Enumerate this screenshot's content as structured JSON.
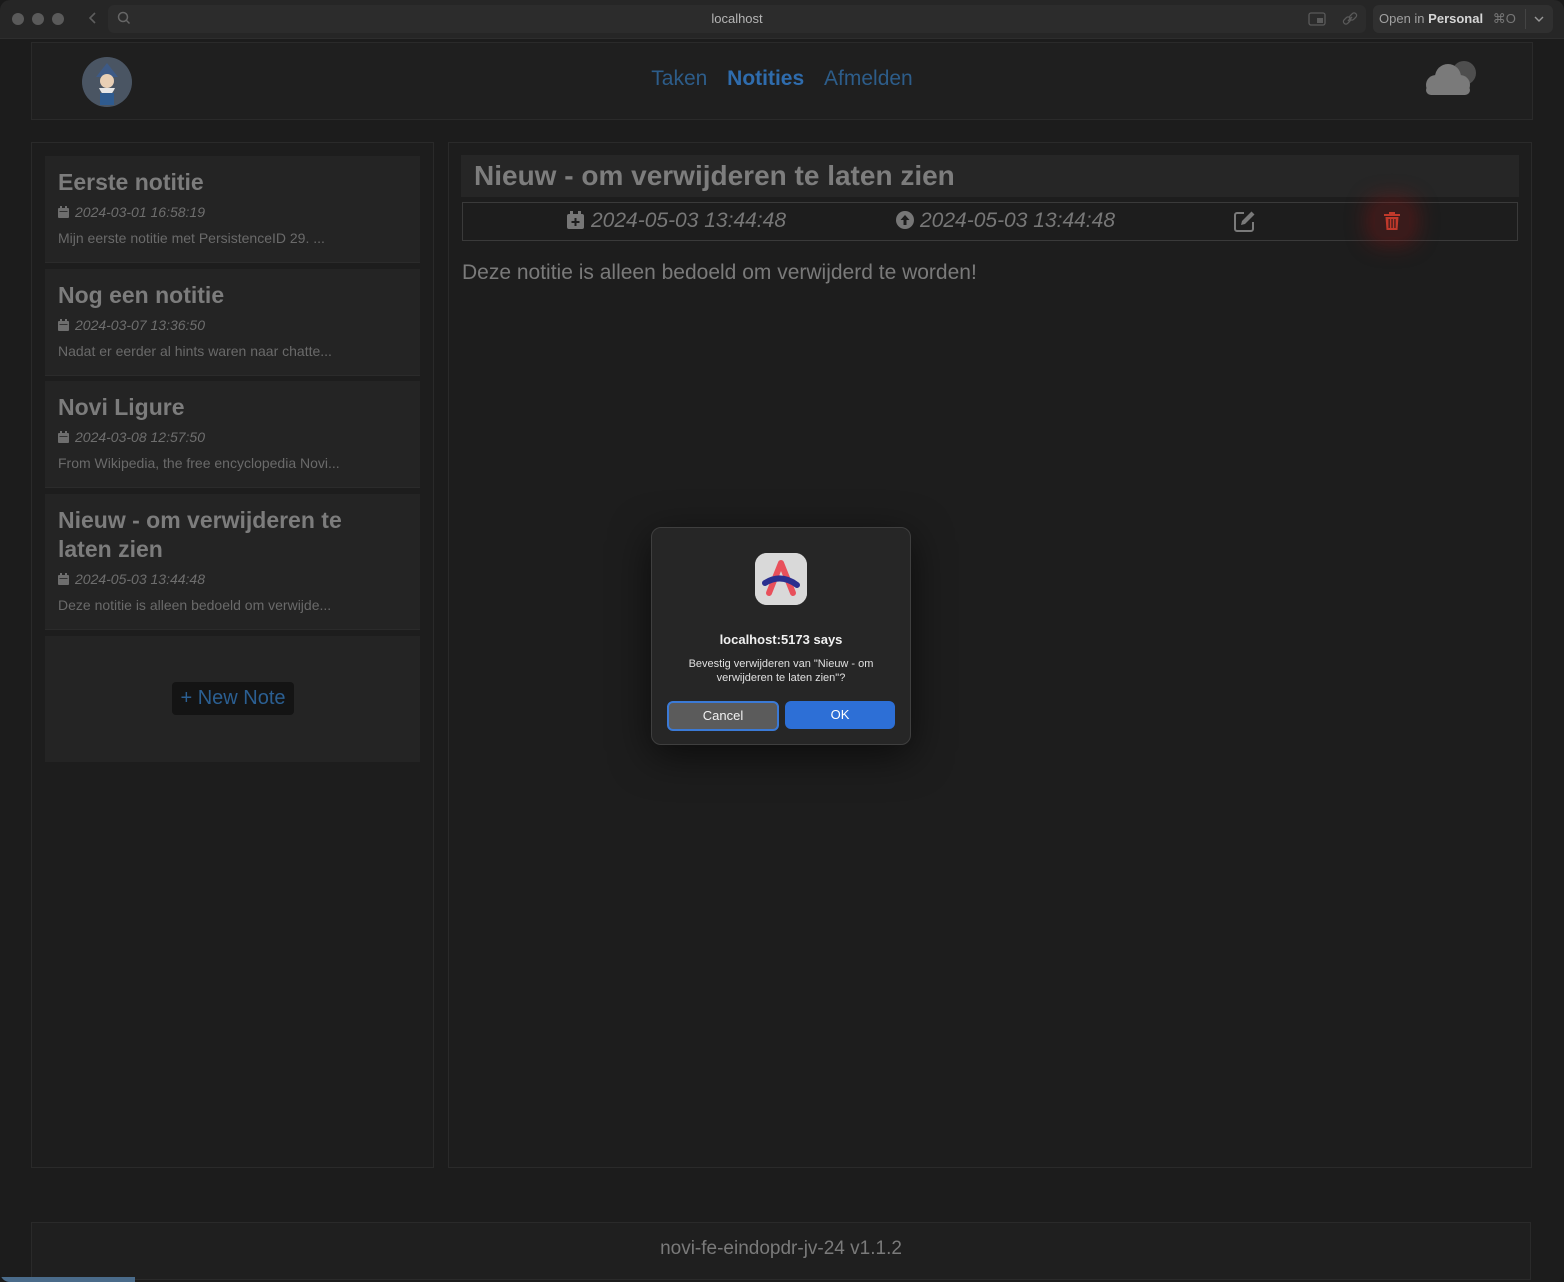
{
  "browser": {
    "url": "localhost",
    "open_in_prefix": "Open in",
    "open_in_profile": "Personal",
    "open_in_shortcut": "⌘O",
    "back_icon": "chevron-left-icon",
    "search_icon": "search-icon"
  },
  "nav": {
    "items": [
      {
        "label": "Taken",
        "active": false
      },
      {
        "label": "Notities",
        "active": true
      },
      {
        "label": "Afmelden",
        "active": false
      }
    ]
  },
  "notes": [
    {
      "title": "Eerste notitie",
      "date": "2024-03-01 16:58:19",
      "snippet": "Mijn eerste notitie met PersistenceID 29. ..."
    },
    {
      "title": "Nog een notitie",
      "date": "2024-03-07 13:36:50",
      "snippet": "Nadat er eerder al hints waren naar chatte..."
    },
    {
      "title": "Novi Ligure",
      "date": "2024-03-08 12:57:50",
      "snippet": "From Wikipedia, the free encyclopedia Novi..."
    },
    {
      "title": "Nieuw - om verwijderen te laten zien",
      "date": "2024-05-03 13:44:48",
      "snippet": "Deze notitie is alleen bedoeld om verwijde..."
    }
  ],
  "new_note_label": "New Note",
  "current_note": {
    "title": "Nieuw - om verwijderen te laten zien",
    "created": "2024-05-03 13:44:48",
    "updated": "2024-05-03 13:44:48",
    "body": "Deze notitie is alleen bedoeld om verwijderd te worden!"
  },
  "footer": {
    "text": "novi-fe-eindopdr-jv-24 v1.1.2"
  },
  "dialog": {
    "title": "localhost:5173 says",
    "message": "Bevestig verwijderen van \"Nieuw - om verwijderen te laten zien\"?",
    "cancel_label": "Cancel",
    "ok_label": "OK"
  },
  "colors": {
    "nav_active": "#2f6cad",
    "nav_link": "#2d5d8a",
    "delete_accent": "#c0392b",
    "dialog_ok": "#2d6fd6"
  }
}
